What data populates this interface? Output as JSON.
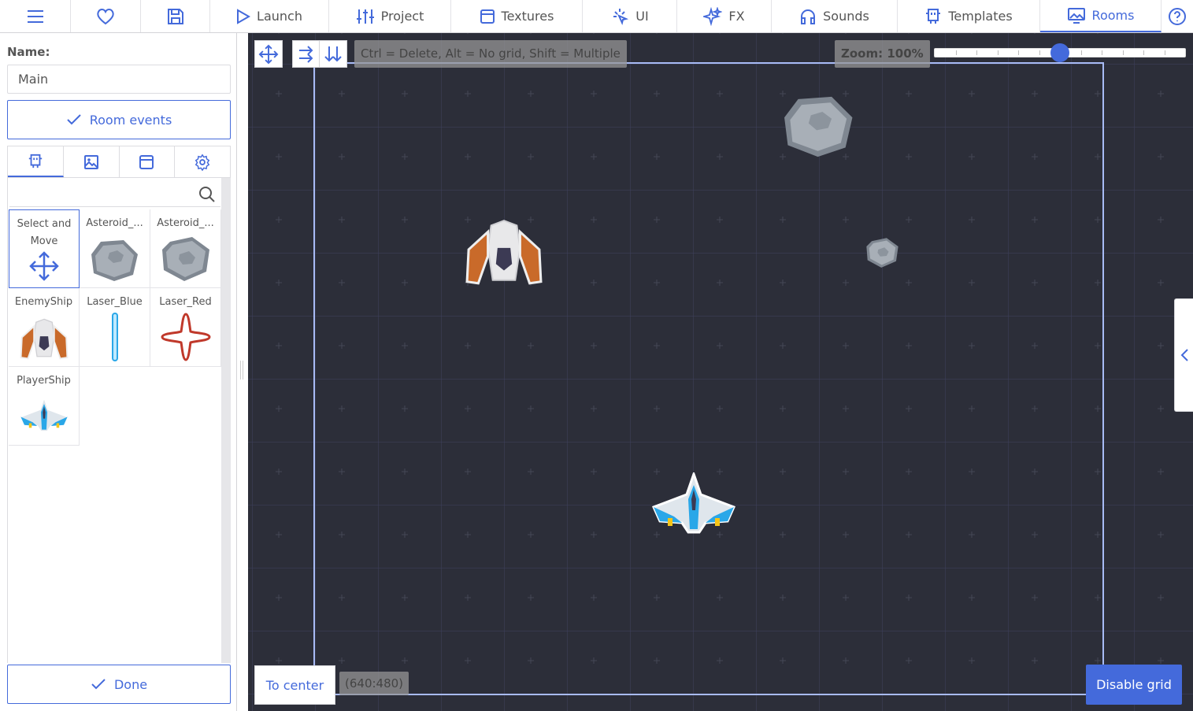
{
  "topbar": {
    "tabs": [
      {
        "label": "Launch",
        "icon": "play-icon"
      },
      {
        "label": "Project",
        "icon": "sliders-icon"
      },
      {
        "label": "Textures",
        "icon": "texture-icon"
      },
      {
        "label": "UI",
        "icon": "pointer-icon"
      },
      {
        "label": "FX",
        "icon": "sparkles-icon"
      },
      {
        "label": "Sounds",
        "icon": "headphones-icon"
      },
      {
        "label": "Templates",
        "icon": "robot-icon"
      },
      {
        "label": "Rooms",
        "icon": "room-icon"
      }
    ],
    "active_tab": "Rooms"
  },
  "sidebar": {
    "name_label": "Name:",
    "name_value": "Main",
    "room_events_label": "Room events",
    "done_label": "Done",
    "search_placeholder": "",
    "templates": [
      {
        "label": "Select and Move",
        "icon": "move-icon"
      },
      {
        "label": "Asteroid_...",
        "icon": "asteroid-icon"
      },
      {
        "label": "Asteroid_...",
        "icon": "asteroid-icon"
      },
      {
        "label": "EnemyShip",
        "icon": "enemy-ship-icon"
      },
      {
        "label": "Laser_Blue",
        "icon": "laser-blue-icon"
      },
      {
        "label": "Laser_Red",
        "icon": "laser-red-icon"
      },
      {
        "label": "PlayerShip",
        "icon": "player-ship-icon"
      }
    ]
  },
  "canvas": {
    "hint": "Ctrl = Delete, Alt = No grid, Shift = Multiple",
    "zoom_label": "Zoom: 100%",
    "zoom_level": 0.5,
    "to_center_label": "To center",
    "coords": "(640:480)",
    "disable_grid_label": "Disable grid"
  },
  "colors": {
    "accent": "#446adb",
    "canvas_bg": "#2c2e39"
  }
}
